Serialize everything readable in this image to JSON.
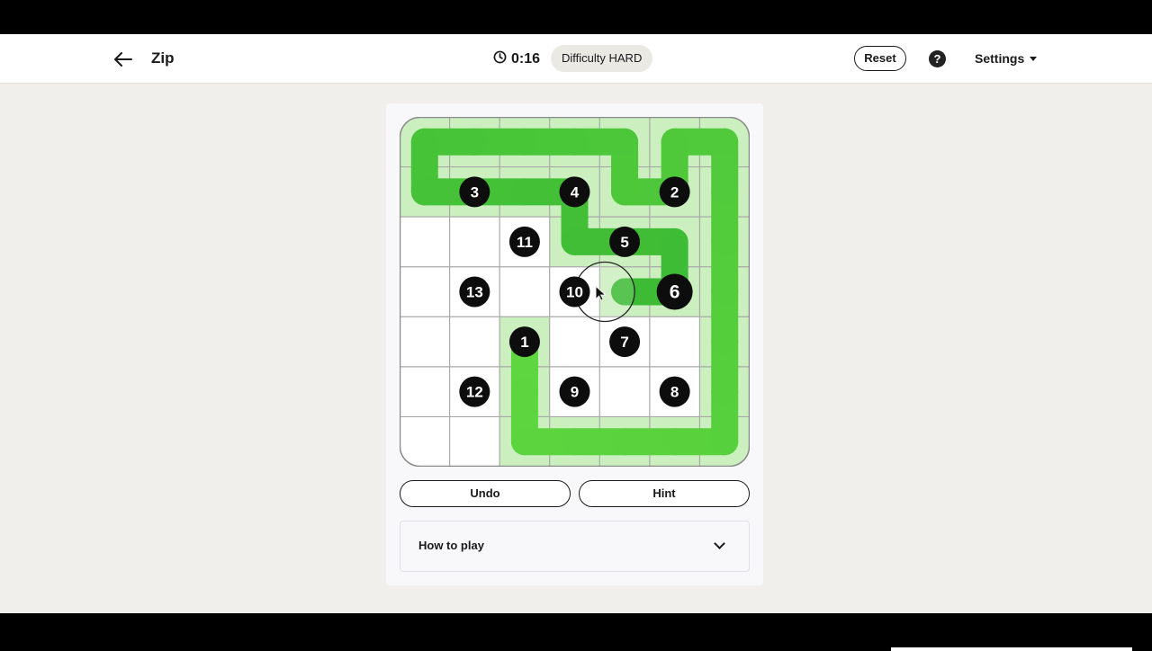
{
  "header": {
    "title": "Zip",
    "timer": "0:16",
    "difficulty": "Difficulty HARD",
    "reset_label": "Reset",
    "help_label": "?",
    "settings_label": "Settings"
  },
  "board": {
    "rows": 7,
    "cols": 7,
    "numbers": [
      {
        "label": "3",
        "row": 1,
        "col": 1
      },
      {
        "label": "4",
        "row": 1,
        "col": 3
      },
      {
        "label": "2",
        "row": 1,
        "col": 5
      },
      {
        "label": "11",
        "row": 2,
        "col": 2
      },
      {
        "label": "5",
        "row": 2,
        "col": 4
      },
      {
        "label": "13",
        "row": 3,
        "col": 1
      },
      {
        "label": "10",
        "row": 3,
        "col": 3
      },
      {
        "label": "6",
        "row": 3,
        "col": 5
      },
      {
        "label": "1",
        "row": 4,
        "col": 2
      },
      {
        "label": "7",
        "row": 4,
        "col": 4
      },
      {
        "label": "12",
        "row": 5,
        "col": 1
      },
      {
        "label": "9",
        "row": 5,
        "col": 3
      },
      {
        "label": "8",
        "row": 5,
        "col": 5
      }
    ],
    "path": [
      [
        4,
        2
      ],
      [
        5,
        2
      ],
      [
        6,
        2
      ],
      [
        6,
        3
      ],
      [
        6,
        4
      ],
      [
        6,
        5
      ],
      [
        6,
        6
      ],
      [
        5,
        6
      ],
      [
        4,
        6
      ],
      [
        3,
        6
      ],
      [
        2,
        6
      ],
      [
        1,
        6
      ],
      [
        0,
        6
      ],
      [
        0,
        5
      ],
      [
        1,
        5
      ],
      [
        1,
        4
      ],
      [
        0,
        4
      ],
      [
        0,
        3
      ],
      [
        0,
        2
      ],
      [
        0,
        1
      ],
      [
        0,
        0
      ],
      [
        1,
        0
      ],
      [
        1,
        1
      ],
      [
        1,
        2
      ],
      [
        1,
        3
      ],
      [
        2,
        3
      ],
      [
        2,
        4
      ],
      [
        2,
        5
      ],
      [
        3,
        5
      ],
      [
        3,
        4
      ]
    ],
    "colors": {
      "path_light": "#5ed63f",
      "path_dark": "#3cba34",
      "cell_fill": "#cbefbf",
      "grid": "#a9a9a9",
      "node": "#0d0d0d"
    }
  },
  "controls": {
    "undo_label": "Undo",
    "hint_label": "Hint",
    "how_to_label": "How to play"
  }
}
